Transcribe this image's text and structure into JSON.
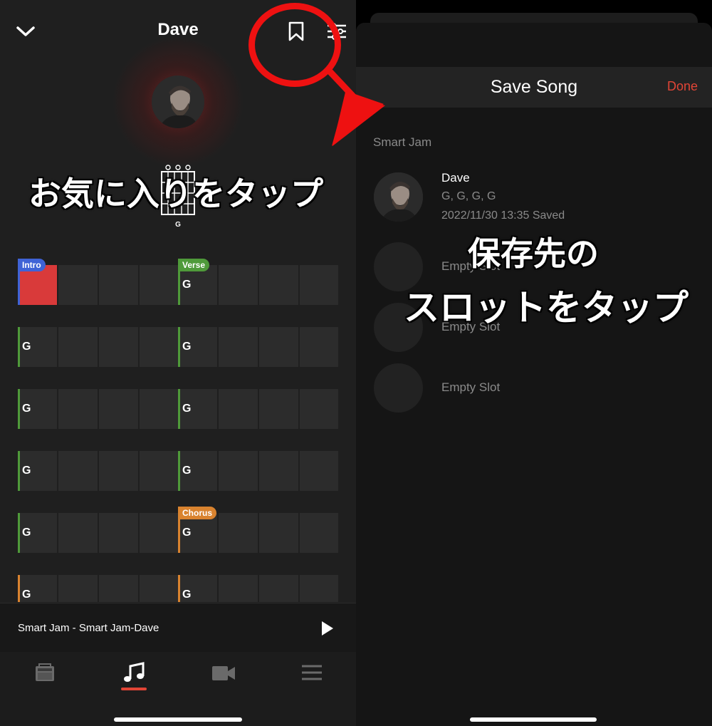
{
  "left": {
    "title": "Dave",
    "chord_diagram_label": "G",
    "sections": {
      "intro": "Intro",
      "verse": "Verse",
      "chorus": "Chorus"
    },
    "rows": [
      {
        "left": [
          "",
          "",
          "",
          ""
        ],
        "right": [
          "G",
          "",
          "",
          ""
        ]
      },
      {
        "left": [
          "G",
          "",
          "",
          ""
        ],
        "right": [
          "G",
          "",
          "",
          ""
        ]
      },
      {
        "left": [
          "G",
          "",
          "",
          ""
        ],
        "right": [
          "G",
          "",
          "",
          ""
        ]
      },
      {
        "left": [
          "G",
          "",
          "",
          ""
        ],
        "right": [
          "G",
          "",
          "",
          ""
        ]
      },
      {
        "left": [
          "G",
          "",
          "",
          ""
        ],
        "right": [
          "G",
          "",
          "",
          ""
        ]
      },
      {
        "left": [
          "G",
          "",
          "",
          ""
        ],
        "right": [
          "G",
          "",
          "",
          ""
        ]
      }
    ],
    "now_playing": "Smart Jam - Smart Jam-Dave",
    "tabs": [
      "amp-icon",
      "music-note-icon",
      "video-camera-icon",
      "menu-icon"
    ],
    "active_tab": 1
  },
  "right": {
    "title": "Save Song",
    "done": "Done",
    "section": "Smart Jam",
    "slots": [
      {
        "name": "Dave",
        "chords": "G, G, G, G",
        "saved": "2022/11/30 13:35 Saved"
      },
      {
        "name": "Empty Slot"
      },
      {
        "name": "Empty Slot"
      },
      {
        "name": "Empty Slot"
      }
    ]
  },
  "annotations": {
    "tap_favorite": "お気に入りをタップ",
    "tap_slot_line1": "保存先の",
    "tap_slot_line2": "スロットをタップ"
  },
  "colors": {
    "accent_red": "#e14536",
    "intro": "#3f63d6",
    "verse": "#4f9a3a",
    "chorus": "#d9832f",
    "annotation_red": "#ee1111"
  }
}
